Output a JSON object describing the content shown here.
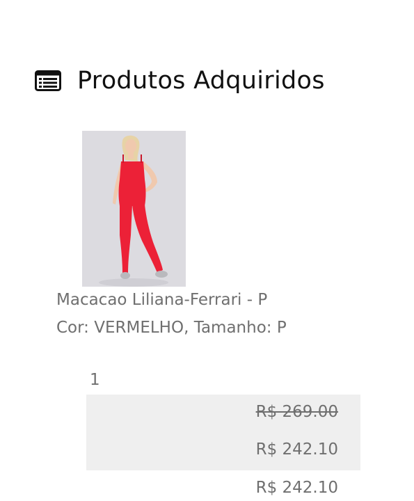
{
  "section": {
    "title": "Produtos Adquiridos",
    "icon": "list-icon"
  },
  "product": {
    "image_icon": "product-photo",
    "image_description": "Red Ferrari jumpsuit product photo",
    "name": "Macacao Liliana-Ferrari - P",
    "variant": "Cor: VERMELHO, Tamanho: P",
    "quantity": "1",
    "original_price": "R$ 269.00",
    "discounted_price": "R$ 242.10",
    "total_price": "R$ 242.10"
  },
  "colors": {
    "title": "#111111",
    "text": "#6f6f6f",
    "price_box_background": "#efefef",
    "jumpsuit": "#ec2137",
    "photo_background": "#dcdbe0"
  }
}
